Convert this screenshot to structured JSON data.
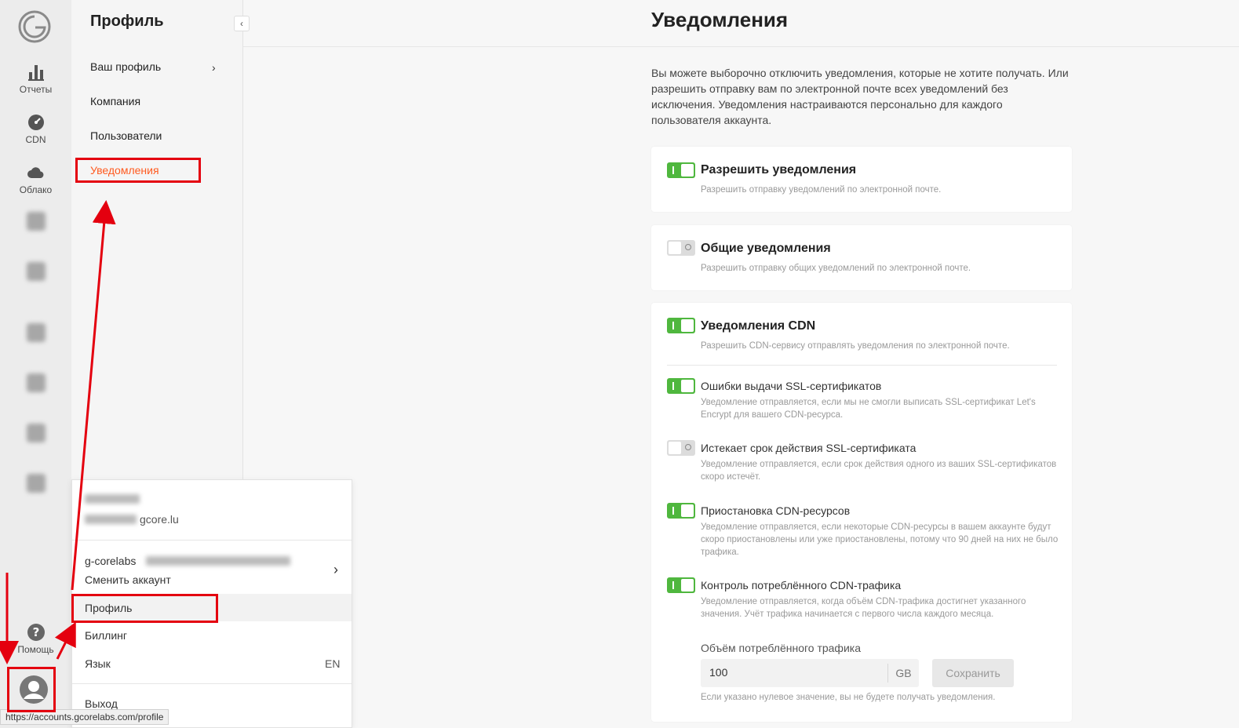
{
  "rail": {
    "items": [
      {
        "label": "Отчеты",
        "icon": "bar-chart-icon"
      },
      {
        "label": "CDN",
        "icon": "speedometer-icon"
      },
      {
        "label": "Облако",
        "icon": "cloud-icon"
      }
    ],
    "help_label": "Помощь"
  },
  "submenu": {
    "title": "Профиль",
    "collapse": "‹",
    "items": [
      "Ваш профиль",
      "Компания",
      "Пользователи",
      "Уведомления"
    ],
    "chevron": "›"
  },
  "main": {
    "title": "Уведомления",
    "intro": "Вы можете выборочно отключить уведомления, которые не хотите получать. Или разрешить отправку вам по электронной почте всех уведомлений без исключения. Уведомления настраиваются персонально для каждого пользователя аккаунта.",
    "allow": {
      "title": "Разрешить уведомления",
      "desc": "Разрешить отправку уведомлений по электронной почте.",
      "enabled": true
    },
    "general": {
      "title": "Общие уведомления",
      "desc": "Разрешить отправку общих уведомлений по электронной почте.",
      "enabled": false
    },
    "cdn": {
      "title": "Уведомления CDN",
      "desc": "Разрешить CDN-сервису отправлять уведомления по электронной почте.",
      "enabled": true,
      "options": [
        {
          "title": "Ошибки выдачи SSL-сертификатов",
          "desc": "Уведомление отправляется, если мы не смогли выписать SSL-сертификат Let's Encrypt для вашего CDN-ресурса.",
          "enabled": true
        },
        {
          "title": "Истекает срок действия SSL-сертификата",
          "desc": "Уведомление отправляется, если срок действия одного из ваших SSL-сертификатов скоро истечёт.",
          "enabled": false
        },
        {
          "title": "Приостановка CDN-ресурсов",
          "desc": "Уведомление отправляется, если некоторые CDN-ресурсы в вашем аккаунте будут скоро приостановлены или уже приостановлены, потому что 90 дней на них не было трафика.",
          "enabled": true
        },
        {
          "title": "Контроль потреблённого CDN-трафика",
          "desc": "Уведомление отправляется, когда объём CDN-трафика достигнет указанного значения. Учёт трафика начинается с первого числа каждого месяца.",
          "enabled": true
        }
      ],
      "traffic": {
        "label": "Объём потреблённого трафика",
        "value": "100",
        "unit": "GB",
        "save": "Сохранить",
        "hint": "Если указано нулевое значение, вы не будете получать уведомления."
      }
    }
  },
  "dropdown": {
    "email_suffix": "gcore.lu",
    "account_name": "g-corelabs",
    "switch_account": "Сменить аккаунт",
    "chevron": "›",
    "profile": "Профиль",
    "billing": "Биллинг",
    "language_label": "Язык",
    "language_value": "EN",
    "logout": "Выход"
  },
  "status_url": "https://accounts.gcorelabs.com/profile",
  "colors": {
    "accent": "#ff5a1f",
    "toggle_on": "#4fb73e",
    "annotation": "#e4000f"
  }
}
